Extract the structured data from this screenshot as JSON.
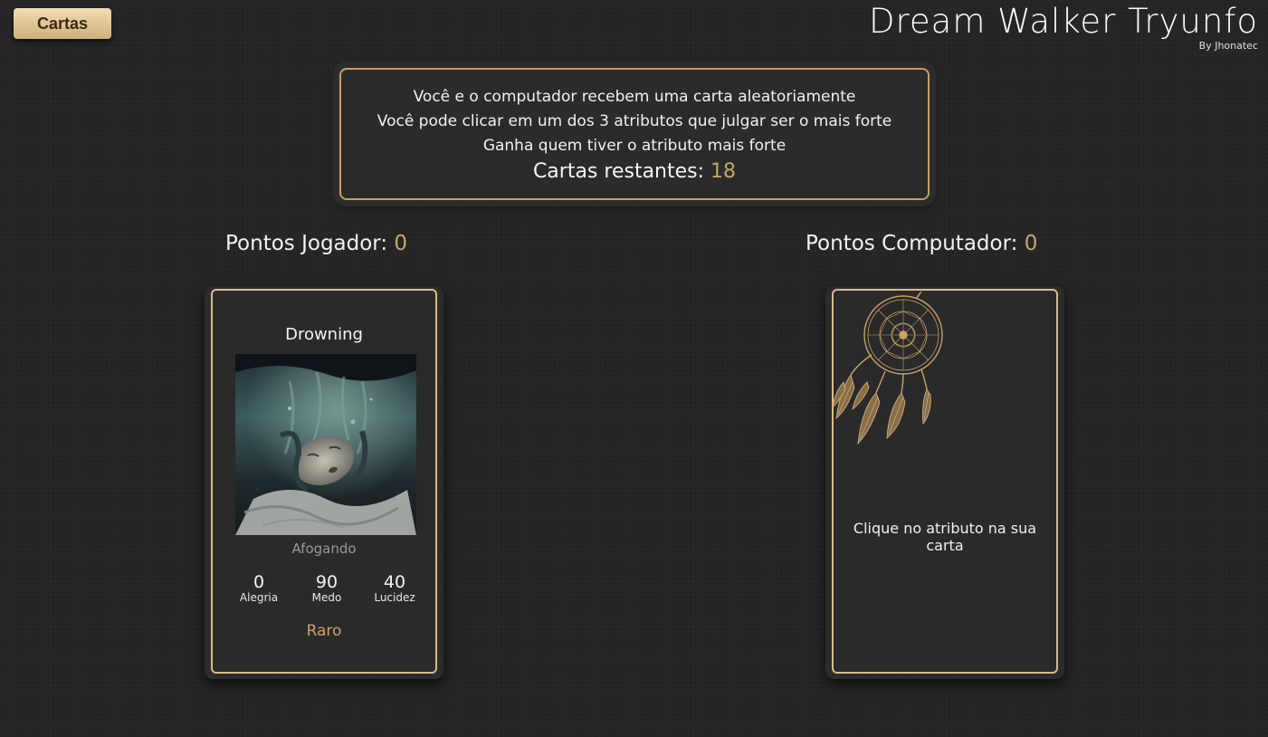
{
  "header": {
    "cards_button": "Cartas",
    "title": "Dream Walker Tryunfo",
    "subtitle": "By Jhonatec"
  },
  "info": {
    "line1": "Você e o computador recebem uma carta aleatoriamente",
    "line2": "Você pode clicar em um dos 3 atributos que julgar ser o mais forte",
    "line3": "Ganha quem tiver o atributo mais forte",
    "remaining_label": "Cartas restantes:",
    "remaining_value": "18"
  },
  "scores": {
    "player_label": "Pontos Jogador:",
    "player_value": "0",
    "cpu_label": "Pontos Computador:",
    "cpu_value": "0"
  },
  "player_card": {
    "name": "Drowning",
    "subtitle": "Afogando",
    "attributes": [
      {
        "value": "0",
        "label": "Alegria"
      },
      {
        "value": "90",
        "label": "Medo"
      },
      {
        "value": "40",
        "label": "Lucidez"
      }
    ],
    "rarity": "Raro",
    "art_icon": "drowning-face-illustration"
  },
  "cpu_card": {
    "message": "Clique no atributo na sua carta",
    "art_icon": "dreamcatcher-icon"
  },
  "colors": {
    "background": "#252525",
    "accent_gold": "#c9a46a",
    "card_border": "#d8bb8a",
    "button_gradient_top": "#f1dcb4",
    "button_gradient_bottom": "#cfb07c"
  }
}
